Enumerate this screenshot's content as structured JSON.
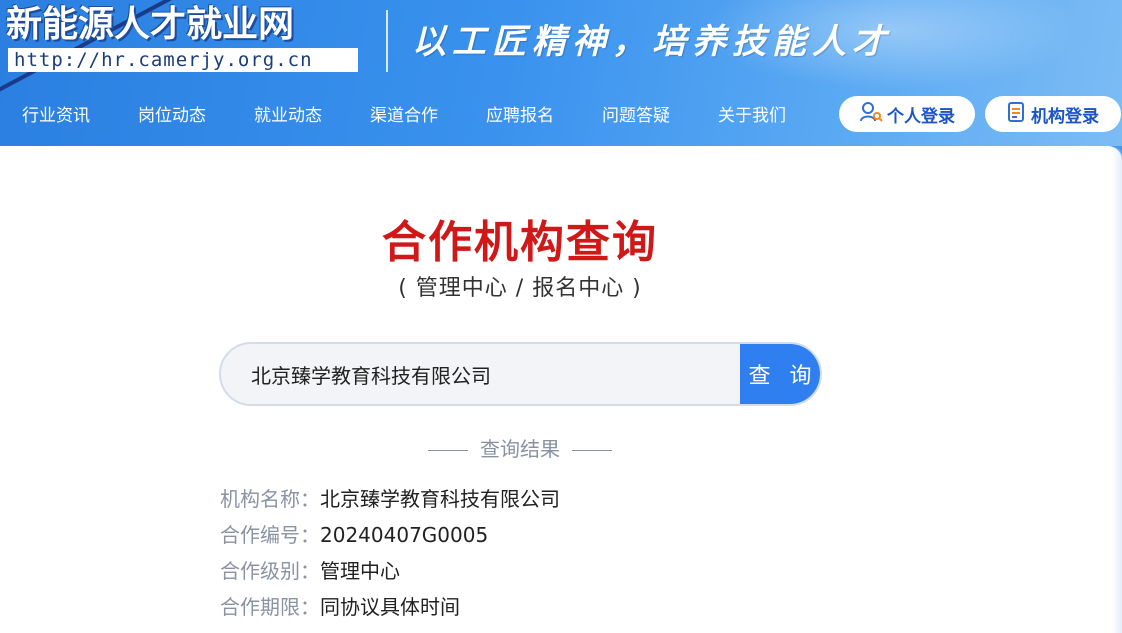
{
  "header": {
    "site_title": "新能源人才就业网",
    "site_url": "http://hr.camerjy.org.cn",
    "slogan": "以工匠精神，培养技能人才"
  },
  "nav": {
    "items": [
      {
        "label": "行业资讯"
      },
      {
        "label": "岗位动态"
      },
      {
        "label": "就业动态"
      },
      {
        "label": "渠道合作"
      },
      {
        "label": "应聘报名"
      },
      {
        "label": "问题答疑"
      },
      {
        "label": "关于我们"
      }
    ],
    "personal_login": "个人登录",
    "org_login": "机构登录"
  },
  "main": {
    "title": "合作机构查询",
    "subtitle": "( 管理中心 / 报名中心 )",
    "search": {
      "value": "北京臻学教育科技有限公司",
      "button_label": "查 询"
    },
    "result_heading": "查询结果",
    "results": [
      {
        "key": "机构名称：",
        "value": "北京臻学教育科技有限公司"
      },
      {
        "key": "合作编号：",
        "value": "20240407G0005"
      },
      {
        "key": "合作级别：",
        "value": "管理中心"
      },
      {
        "key": "合作期限：",
        "value": "同协议具体时间"
      }
    ]
  },
  "colors": {
    "title_red": "#d01818",
    "button_blue": "#2f7ff0",
    "header_blue": "#3a92ee",
    "muted_gray": "#8a93a3"
  },
  "icons": {
    "personal_login": "user-search-icon",
    "org_login": "document-icon"
  }
}
